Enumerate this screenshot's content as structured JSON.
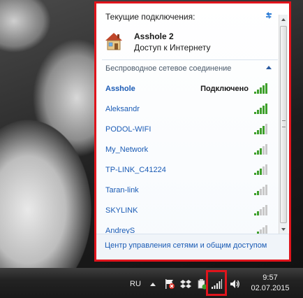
{
  "flyout": {
    "current_connections_label": "Текущие подключения:",
    "current": {
      "name": "Asshole  2",
      "status": "Доступ к Интернету"
    },
    "wireless_section_label": "Беспроводное сетевое соединение",
    "networks": [
      {
        "name": "Asshole",
        "status": "Подключено",
        "bars": 5
      },
      {
        "name": "Aleksandr",
        "status": "",
        "bars": 5
      },
      {
        "name": "PODOL-WIFI",
        "status": "",
        "bars": 4
      },
      {
        "name": "My_Network",
        "status": "",
        "bars": 3
      },
      {
        "name": "TP-LINK_C41224",
        "status": "",
        "bars": 3
      },
      {
        "name": "Taran-link",
        "status": "",
        "bars": 2
      },
      {
        "name": "SKYLINK",
        "status": "",
        "bars": 2
      },
      {
        "name": "AndreyS",
        "status": "",
        "bars": 2
      }
    ],
    "footer_link": "Центр управления сетями и общим доступом"
  },
  "taskbar": {
    "language": "RU",
    "clock_time": "9:57",
    "clock_date": "02.07.2015"
  },
  "colors": {
    "highlight_frame": "#e0141c",
    "link": "#1a5bb5",
    "signal_on": "#3fa02c",
    "signal_off": "#c8c8c8"
  }
}
